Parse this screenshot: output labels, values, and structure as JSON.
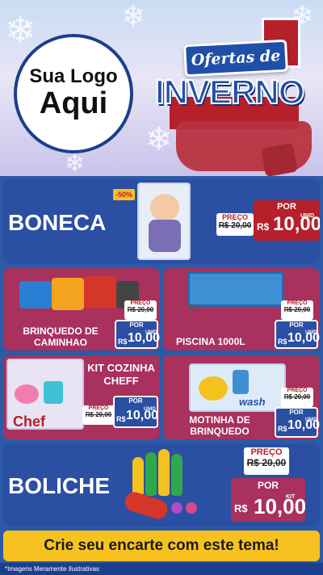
{
  "header": {
    "logo_line1": "Sua Logo",
    "logo_line2": "Aqui",
    "campaign_line1": "Ofertas de",
    "campaign_line2": "INVERNO"
  },
  "products": [
    {
      "name": "BONECA",
      "discount_badge": "-50%",
      "old_label": "PREÇO",
      "old_price": "R$ 20,00",
      "new_label": "POR",
      "currency": "R$",
      "new_price": "10,00",
      "unit": "UNID"
    },
    {
      "name": "BRINQUEDO DE CAMINHAO",
      "old_label": "PREÇO",
      "old_price": "R$ 20,00",
      "new_label": "POR",
      "currency": "R$",
      "new_price": "10,00",
      "unit": "UNID"
    },
    {
      "name": "PISCINA 1000L",
      "old_label": "PREÇO",
      "old_price": "R$ 20,00",
      "new_label": "POR",
      "currency": "R$",
      "new_price": "10,00",
      "unit": "UNID"
    },
    {
      "name": "KIT COZINHA CHEFF",
      "box_text": "Chef",
      "old_label": "PREÇO",
      "old_price": "R$ 20,00",
      "new_label": "POR",
      "currency": "R$",
      "new_price": "10,00",
      "unit": "UNID"
    },
    {
      "name": "MOTINHA DE BRINQUEDO",
      "box_text": "wash",
      "old_label": "PREÇO",
      "old_price": "R$ 20,00",
      "new_label": "POR",
      "currency": "R$",
      "new_price": "10,00",
      "unit": "UNID"
    },
    {
      "name": "BOLICHE",
      "old_label": "PREÇO",
      "old_price": "R$ 20,00",
      "new_label": "POR",
      "currency": "R$",
      "new_price": "10,00",
      "unit": "KIT"
    }
  ],
  "cta": "Crie seu encarte com este tema!",
  "footer_note": "*Imagens Meramente Ilustrativas",
  "colors": {
    "blue_panel": "#2a4fa3",
    "pink_panel": "#a8315d",
    "price_red": "#b5202a",
    "cta_yellow": "#f7c21f"
  }
}
